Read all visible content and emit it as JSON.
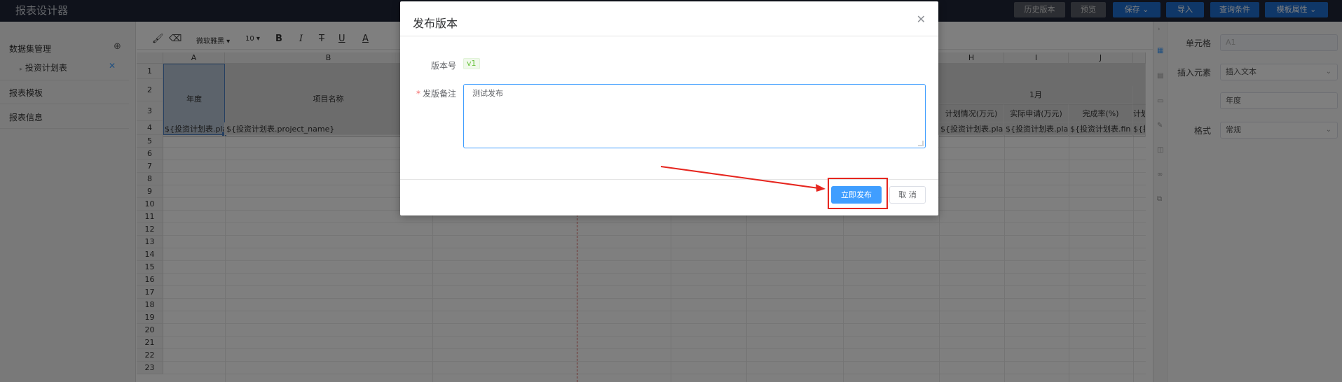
{
  "app": {
    "title": "报表设计器",
    "buttons": {
      "history": "历史版本",
      "preview": "预览",
      "save": "保存",
      "import": "导入",
      "query": "查询条件",
      "template_props": "模板属性"
    }
  },
  "sidebar": {
    "dataset_title": "数据集管理",
    "dataset_item": "投资计划表",
    "template": "报表模板",
    "info": "报表信息"
  },
  "toolbar": {
    "font": "微软雅黑",
    "size": "10"
  },
  "sheet": {
    "columns": [
      "A",
      "B",
      "H",
      "I",
      "J"
    ],
    "rows": [
      "1",
      "2",
      "3",
      "4",
      "5",
      "6",
      "7",
      "8",
      "9",
      "10",
      "11",
      "12",
      "13",
      "14",
      "15",
      "16",
      "17",
      "18",
      "19",
      "20",
      "21",
      "22",
      "23"
    ],
    "a2": "年度",
    "b2": "项目名称",
    "month_header": "1月",
    "h3": "计划情况(万元)",
    "i3": "实际申请(万元)",
    "j3": "完成率(%)",
    "k3": "计划",
    "a4": "${投资计划表.pla",
    "b4": "${投资计划表.project_name}",
    "h4": "${投资计划表.pla",
    "i4": "${投资计划表.pla",
    "j4": "${投资计划表.fin",
    "k4": "${投"
  },
  "right_panel": {
    "cell_label": "单元格",
    "cell_value": "A1",
    "insert_label": "插入元素",
    "insert_value": "插入文本",
    "text_value": "年度",
    "format_label": "格式",
    "format_value": "常规"
  },
  "modal": {
    "title": "发布版本",
    "version_label": "版本号",
    "version_value": "v1",
    "remark_label": "发版备注",
    "remark_value": "测试发布",
    "confirm": "立即发布",
    "cancel": "取 消"
  }
}
